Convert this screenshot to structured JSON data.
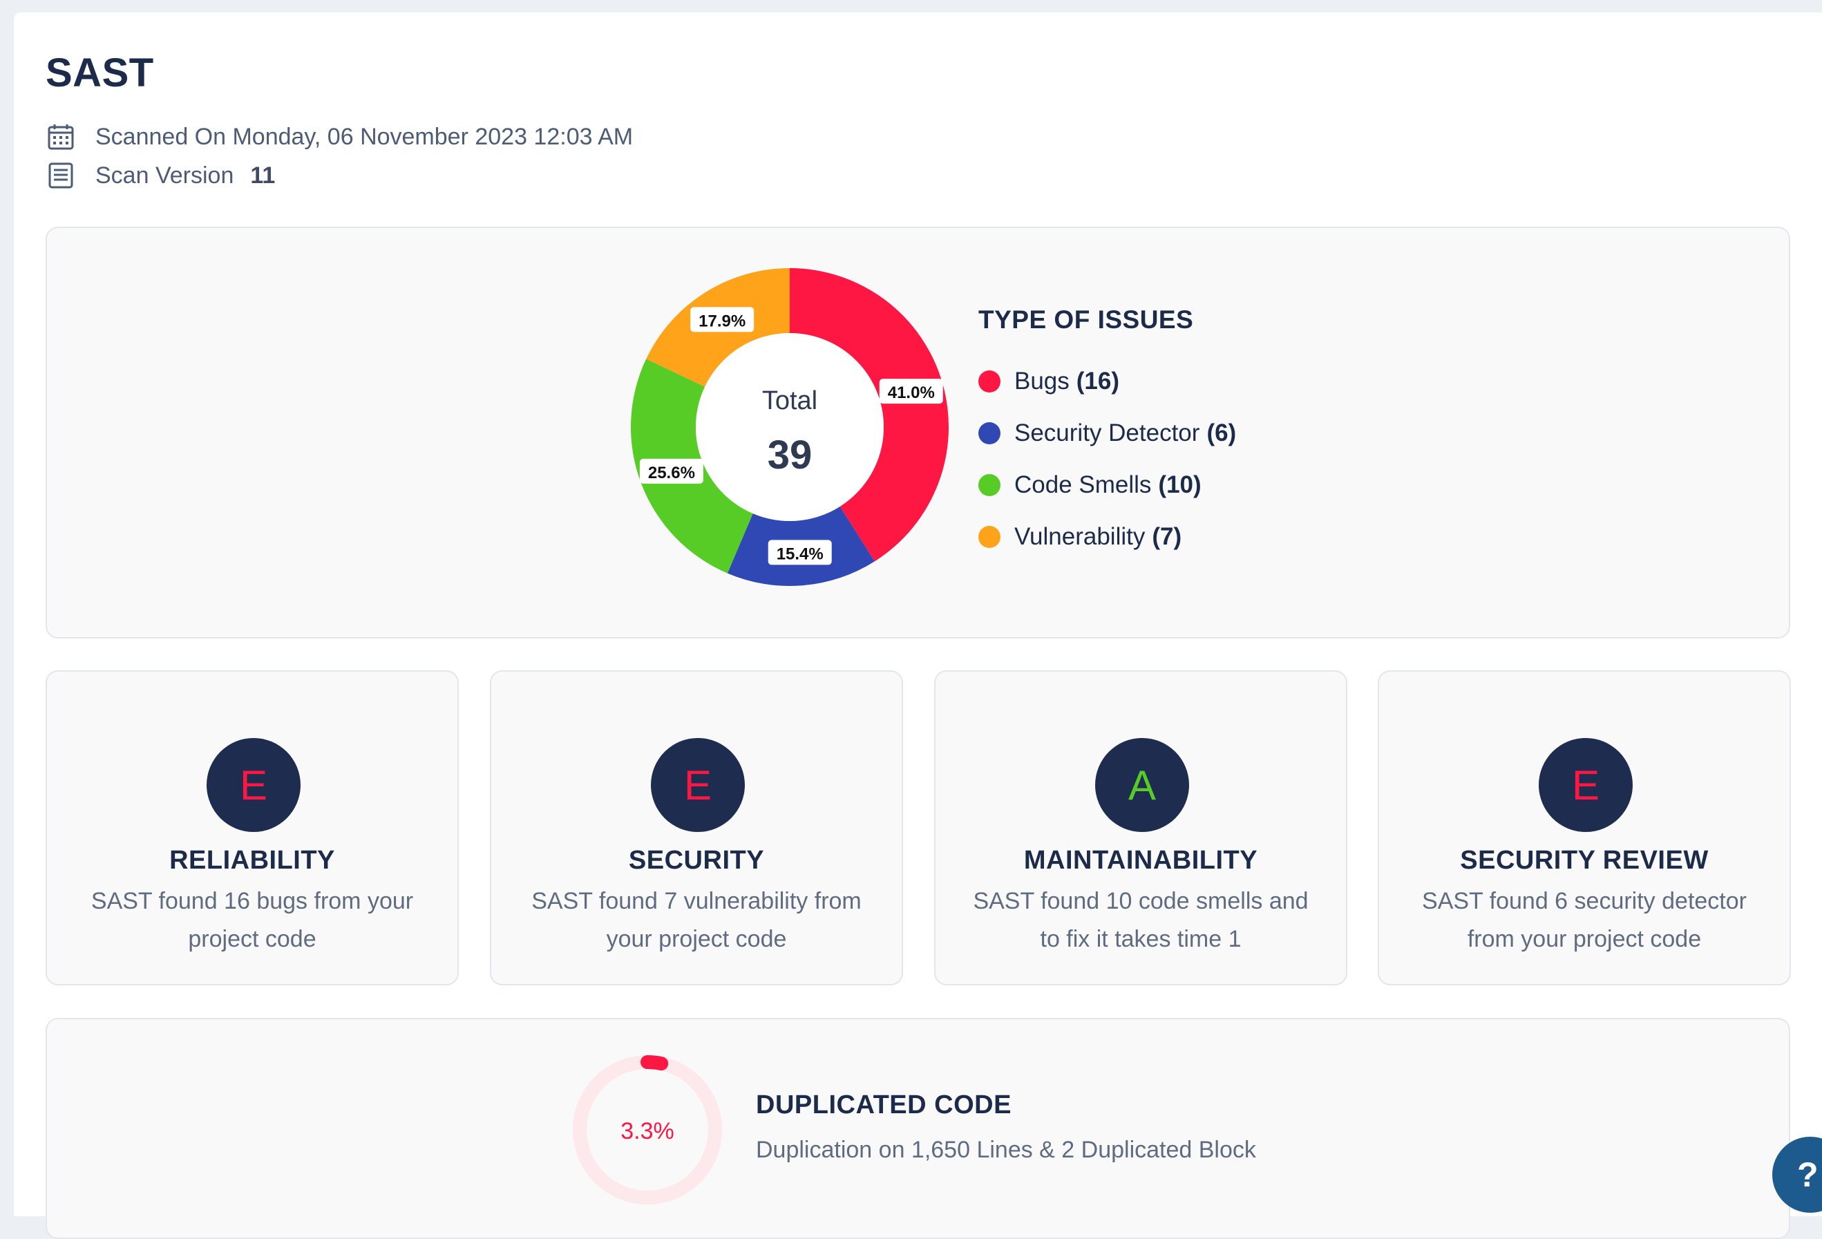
{
  "page": {
    "title": "SAST",
    "scanned_on": "Scanned On Monday, 06 November 2023 12:03 AM",
    "scan_version_label": "Scan Version",
    "scan_version_value": "11"
  },
  "issues": {
    "legend_title": "TYPE OF ISSUES",
    "total_label": "Total",
    "total_value": "39",
    "items": [
      {
        "name": "Bugs",
        "count": "(16)",
        "color": "#ff1744"
      },
      {
        "name": "Security Detector",
        "count": "(6)",
        "color": "#2f48b3"
      },
      {
        "name": "Code Smells",
        "count": "(10)",
        "color": "#57cc26"
      },
      {
        "name": "Vulnerability",
        "count": "(7)",
        "color": "#ffa31a"
      }
    ]
  },
  "chart_data": {
    "type": "pie",
    "categories": [
      "Bugs",
      "Security Detector",
      "Code Smells",
      "Vulnerability"
    ],
    "values": [
      16,
      6,
      10,
      7
    ],
    "percent_labels": [
      "41.0%",
      "15.4%",
      "25.6%",
      "17.9%"
    ],
    "colors": [
      "#ff1744",
      "#2f48b3",
      "#57cc26",
      "#ffa31a"
    ],
    "center_text": [
      "Total",
      "39"
    ],
    "legend_position": "right"
  },
  "grades": [
    {
      "grade": "E",
      "grade_color": "#ff1744",
      "title": "RELIABILITY",
      "desc": "SAST found 16 bugs from your project code"
    },
    {
      "grade": "E",
      "grade_color": "#ff1744",
      "title": "SECURITY",
      "desc": "SAST found 7 vulnerability from your project code"
    },
    {
      "grade": "A",
      "grade_color": "#57cc26",
      "title": "MAINTAINABILITY",
      "desc": "SAST found 10 code smells and to fix it takes time 1"
    },
    {
      "grade": "E",
      "grade_color": "#ff1744",
      "title": "SECURITY REVIEW",
      "desc": "SAST found 6 security detector from your project code"
    }
  ],
  "duplicated": {
    "title": "DUPLICATED CODE",
    "percent_label": "3.3%",
    "percent": 3.3,
    "description": "Duplication on 1,650 Lines & 2 Duplicated Block",
    "color": "#ff1744",
    "track_color": "#fde8eb"
  },
  "help": {
    "label": "?"
  }
}
